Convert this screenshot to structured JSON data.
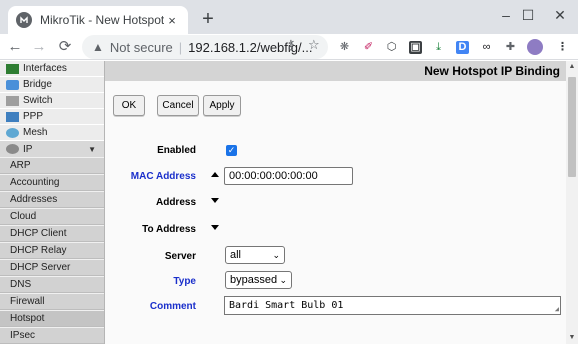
{
  "browser": {
    "tab_title": "MikroTik - New Hotspot IP Binding",
    "tab_close": "×",
    "new_tab": "+",
    "window_controls": {
      "minimize": "–",
      "maximize": "☐",
      "close": "✕"
    },
    "nav": {
      "back": "←",
      "forward": "→",
      "reload": "⟳"
    },
    "security_label": "Not secure",
    "url": "192.168.1.2/webfig/..."
  },
  "menu": {
    "top_items": [
      {
        "label": "Interfaces",
        "icon": "interfaces-icon"
      },
      {
        "label": "Bridge",
        "icon": "bridge-icon"
      },
      {
        "label": "Switch",
        "icon": "switch-icon"
      },
      {
        "label": "PPP",
        "icon": "ppp-icon"
      },
      {
        "label": "Mesh",
        "icon": "mesh-icon"
      }
    ],
    "ip": {
      "label": "IP",
      "arrow": "▼"
    },
    "ip_submenu": [
      "ARP",
      "Accounting",
      "Addresses",
      "Cloud",
      "DHCP Client",
      "DHCP Relay",
      "DHCP Server",
      "DNS",
      "Firewall",
      "Hotspot",
      "IPsec"
    ],
    "active_item": "Hotspot"
  },
  "page": {
    "title": "New Hotspot IP Binding",
    "buttons": {
      "ok": "OK",
      "cancel": "Cancel",
      "apply": "Apply"
    }
  },
  "form": {
    "enabled": {
      "label": "Enabled",
      "checked": true,
      "mark": "✓"
    },
    "mac_address": {
      "label": "MAC Address",
      "value": "00:00:00:00:00:00"
    },
    "address": {
      "label": "Address"
    },
    "to_address": {
      "label": "To Address"
    },
    "server": {
      "label": "Server",
      "value": "all",
      "chevron": "⌄"
    },
    "type": {
      "label": "Type",
      "value": "bypassed",
      "chevron": "⌄"
    },
    "comment": {
      "label": "Comment",
      "value": "Bardi Smart Bulb 01"
    }
  },
  "colors": {
    "link_label": "#1a2fcb",
    "checkbox": "#1a73e8",
    "titlebar": "#d4d4d4",
    "menu_bg": "#f0f0f0",
    "submenu_bg": "#d2d2d2"
  }
}
